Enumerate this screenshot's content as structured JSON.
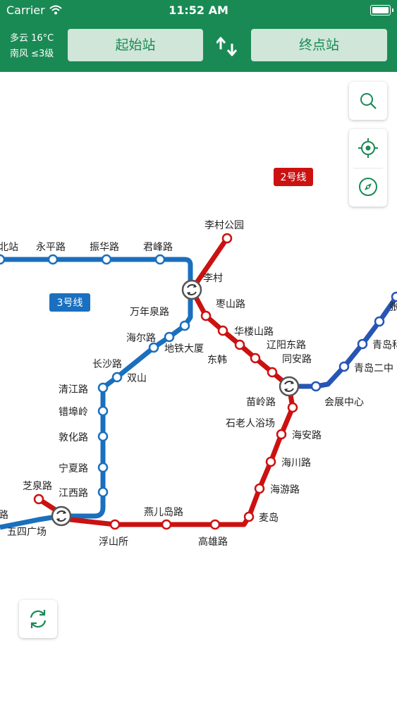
{
  "status_bar": {
    "carrier": "Carrier",
    "time": "11:52 AM"
  },
  "weather": {
    "condition": "多云 16°C",
    "wind": "南风 ≤3级"
  },
  "route": {
    "start_label": "起始站",
    "end_label": "终点站"
  },
  "colors": {
    "header": "#1a8a55",
    "line2": "#cc1111",
    "line3": "#1a6fbe",
    "line_right": "#2655b4"
  },
  "icons": [
    "wifi-icon",
    "battery-icon",
    "swap-icon",
    "search-icon",
    "locate-icon",
    "compass-icon",
    "refresh-icon",
    "transfer-icon"
  ],
  "lines": {
    "line2": "2号线",
    "line3": "3号线"
  },
  "stations": {
    "beizhan": "北站",
    "yongpinglu": "永平路",
    "zhenhualu": "振华路",
    "junfenglu": "君峰路",
    "licungongyuan": "李村公园",
    "licun": "李村",
    "zaoshanlu": "枣山路",
    "wanniaquanlu": "万年泉路",
    "haierlu": "海尔路",
    "ditiedasha": "地铁大厦",
    "hualoushanlu": "华楼山路",
    "liaoyangdonglu": "辽阳东路",
    "donghan": "东韩",
    "tonganlu": "同安路",
    "changshalu": "长沙路",
    "shuangshan": "双山",
    "qingjianglu": "清江路",
    "cuobuling": "错埠岭",
    "dunhualu": "敦化路",
    "ningxialu": "宁夏路",
    "jiangxilu": "江西路",
    "zhiquanlu": "芝泉路",
    "wusiguangchang": "五四广场",
    "lu_left": "路",
    "fushansuo": "浮山所",
    "yanerdaolu": "燕儿岛路",
    "gaoxionglu": "高雄路",
    "maidao": "麦岛",
    "haiyoulu": "海游路",
    "haichuanlu": "海川路",
    "haianlu": "海安路",
    "shilaorenyuchang": "石老人浴场",
    "miaolinglu": "苗岭路",
    "huizhanzhongxin": "会展中心",
    "qingdaoerzhong": "青岛二中",
    "qingdaoke": "青岛科",
    "zhang": "张"
  }
}
